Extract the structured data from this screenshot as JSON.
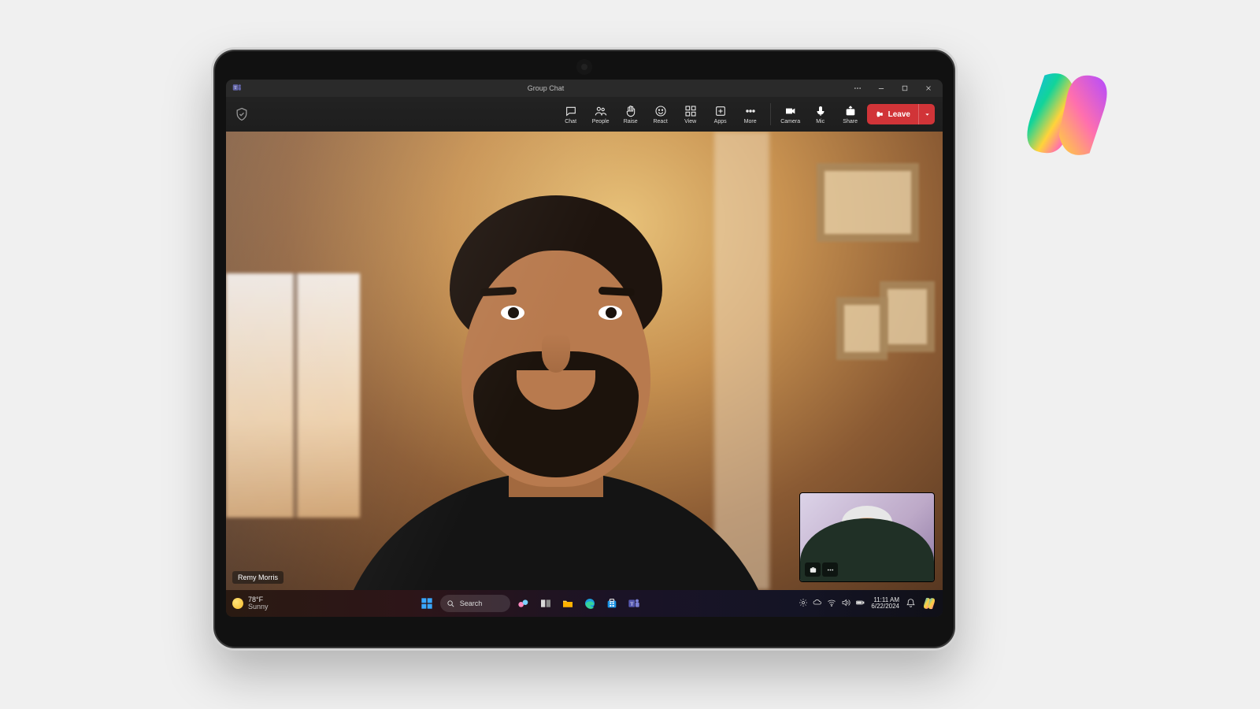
{
  "window": {
    "title": "Group Chat"
  },
  "toolbar": {
    "chat": {
      "label": "Chat"
    },
    "people": {
      "label": "People"
    },
    "raise": {
      "label": "Raise"
    },
    "react": {
      "label": "React"
    },
    "view": {
      "label": "View"
    },
    "apps": {
      "label": "Apps"
    },
    "more": {
      "label": "More"
    },
    "camera": {
      "label": "Camera"
    },
    "mic": {
      "label": "Mic"
    },
    "share": {
      "label": "Share"
    },
    "leave": {
      "label": "Leave"
    }
  },
  "video": {
    "main_participant_name": "Remy Morris"
  },
  "taskbar": {
    "weather": {
      "temp": "78°F",
      "condition": "Sunny"
    },
    "search": {
      "placeholder": "Search"
    },
    "clock": {
      "time": "11:11 AM",
      "date": "6/22/2024"
    }
  }
}
